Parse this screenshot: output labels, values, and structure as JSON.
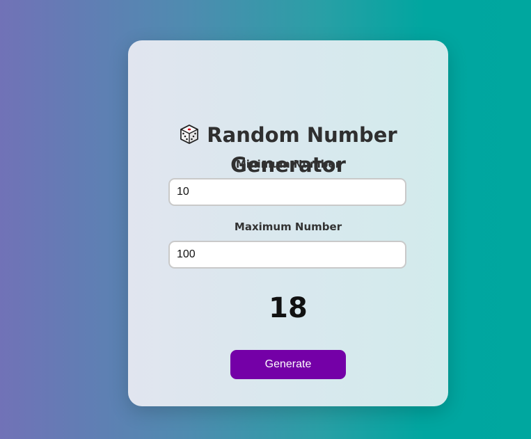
{
  "title": {
    "icon": "dice-icon",
    "text": "Random Number Generator"
  },
  "min": {
    "label": "Minimum Number",
    "value": "10"
  },
  "max": {
    "label": "Maximum Number",
    "value": "100"
  },
  "result": "18",
  "generate_label": "Generate",
  "colors": {
    "button": "#7400a7",
    "card": "#dde8ee",
    "background_left": "#7172b7",
    "background_right": "#00a79f"
  }
}
